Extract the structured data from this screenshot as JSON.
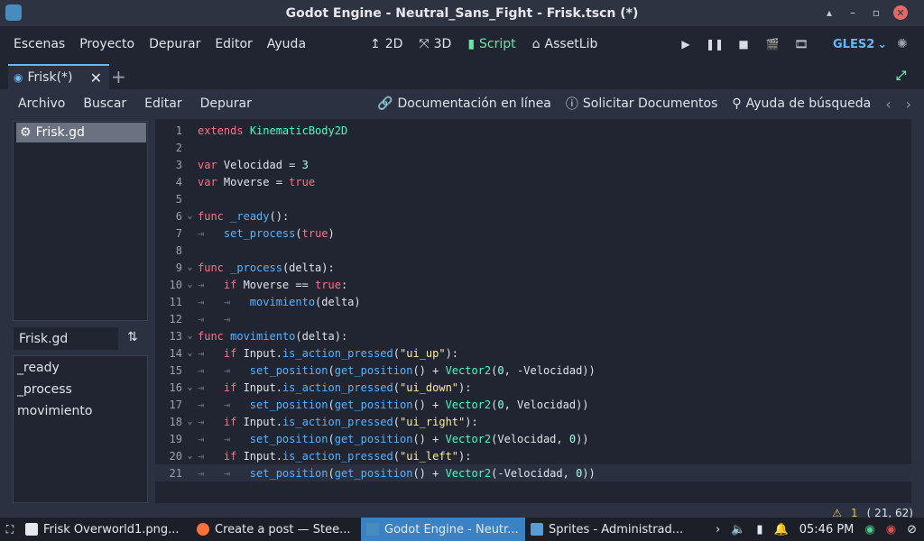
{
  "window": {
    "title": "Godot Engine - Neutral_Sans_Fight - Frisk.tscn (*)",
    "controls": [
      "▴",
      "–",
      "▫"
    ]
  },
  "menu": {
    "items": [
      "Escenas",
      "Proyecto",
      "Depurar",
      "Editor",
      "Ayuda"
    ],
    "modes": [
      {
        "label": "2D",
        "icon": "2d-icon"
      },
      {
        "label": "3D",
        "icon": "3d-icon"
      },
      {
        "label": "Script",
        "icon": "script-icon"
      },
      {
        "label": "AssetLib",
        "icon": "assetlib-icon"
      }
    ],
    "active_mode": "Script",
    "renderer": "GLES2"
  },
  "scene_tab": {
    "label": "Frisk(*)"
  },
  "script_menu": {
    "items": [
      "Archivo",
      "Buscar",
      "Editar",
      "Depurar"
    ],
    "right": [
      {
        "label": "Documentación en línea",
        "icon": "link-icon"
      },
      {
        "label": "Solicitar Documentos",
        "icon": "help-circle-icon"
      },
      {
        "label": "Ayuda de búsqueda",
        "icon": "search-help-icon"
      }
    ]
  },
  "script_list": {
    "selected": "Frisk.gd"
  },
  "filter": {
    "value": "Frisk.gd"
  },
  "methods": [
    "_ready",
    "_process",
    "movimiento"
  ],
  "code": [
    {
      "n": "1",
      "fold": "",
      "parts": [
        [
          "kw",
          "extends"
        ],
        [
          "t",
          " "
        ],
        [
          "ty",
          "KinematicBody2D"
        ]
      ]
    },
    {
      "n": "2",
      "fold": "",
      "parts": []
    },
    {
      "n": "3",
      "fold": "",
      "parts": [
        [
          "kw",
          "var"
        ],
        [
          "t",
          " Velocidad = "
        ],
        [
          "num",
          "3"
        ]
      ]
    },
    {
      "n": "4",
      "fold": "",
      "parts": [
        [
          "kw",
          "var"
        ],
        [
          "t",
          " Moverse = "
        ],
        [
          "kw",
          "true"
        ]
      ]
    },
    {
      "n": "5",
      "fold": "",
      "parts": []
    },
    {
      "n": "6",
      "fold": "⌄",
      "parts": [
        [
          "kw",
          "func"
        ],
        [
          "t",
          " "
        ],
        [
          "fn",
          "_ready"
        ],
        [
          "t",
          "():"
        ]
      ]
    },
    {
      "n": "7",
      "fold": "",
      "parts": [
        [
          "tab",
          "⇥   "
        ],
        [
          "fn",
          "set_process"
        ],
        [
          "t",
          "("
        ],
        [
          "kw",
          "true"
        ],
        [
          "t",
          ")"
        ]
      ]
    },
    {
      "n": "8",
      "fold": "",
      "parts": []
    },
    {
      "n": "9",
      "fold": "⌄",
      "parts": [
        [
          "kw",
          "func"
        ],
        [
          "t",
          " "
        ],
        [
          "fn",
          "_process"
        ],
        [
          "t",
          "(delta):"
        ]
      ]
    },
    {
      "n": "10",
      "fold": "⌄",
      "parts": [
        [
          "tab",
          "⇥   "
        ],
        [
          "kw",
          "if"
        ],
        [
          "t",
          " Moverse == "
        ],
        [
          "kw",
          "true"
        ],
        [
          "t",
          ":"
        ]
      ]
    },
    {
      "n": "11",
      "fold": "",
      "parts": [
        [
          "tab",
          "⇥   ⇥   "
        ],
        [
          "fn",
          "movimiento"
        ],
        [
          "t",
          "(delta)"
        ]
      ]
    },
    {
      "n": "12",
      "fold": "",
      "parts": [
        [
          "tab",
          "⇥   ⇥"
        ]
      ]
    },
    {
      "n": "13",
      "fold": "⌄",
      "parts": [
        [
          "kw",
          "func"
        ],
        [
          "t",
          " "
        ],
        [
          "fn",
          "movimiento"
        ],
        [
          "t",
          "(delta):"
        ]
      ]
    },
    {
      "n": "14",
      "fold": "⌄",
      "parts": [
        [
          "tab",
          "⇥   "
        ],
        [
          "kw",
          "if"
        ],
        [
          "t",
          " Input."
        ],
        [
          "fn",
          "is_action_pressed"
        ],
        [
          "t",
          "("
        ],
        [
          "str",
          "\"ui_up\""
        ],
        [
          "t",
          "):"
        ]
      ]
    },
    {
      "n": "15",
      "fold": "",
      "parts": [
        [
          "tab",
          "⇥   ⇥   "
        ],
        [
          "fn",
          "set_position"
        ],
        [
          "t",
          "("
        ],
        [
          "fn",
          "get_position"
        ],
        [
          "t",
          "() + "
        ],
        [
          "ty",
          "Vector2"
        ],
        [
          "t",
          "("
        ],
        [
          "num",
          "0"
        ],
        [
          "t",
          ", -Velocidad))"
        ]
      ]
    },
    {
      "n": "16",
      "fold": "⌄",
      "parts": [
        [
          "tab",
          "⇥   "
        ],
        [
          "kw",
          "if"
        ],
        [
          "t",
          " Input."
        ],
        [
          "fn",
          "is_action_pressed"
        ],
        [
          "t",
          "("
        ],
        [
          "str",
          "\"ui_down\""
        ],
        [
          "t",
          "):"
        ]
      ]
    },
    {
      "n": "17",
      "fold": "",
      "parts": [
        [
          "tab",
          "⇥   ⇥   "
        ],
        [
          "fn",
          "set_position"
        ],
        [
          "t",
          "("
        ],
        [
          "fn",
          "get_position"
        ],
        [
          "t",
          "() + "
        ],
        [
          "ty",
          "Vector2"
        ],
        [
          "t",
          "("
        ],
        [
          "num",
          "0"
        ],
        [
          "t",
          ", Velocidad))"
        ]
      ]
    },
    {
      "n": "18",
      "fold": "⌄",
      "parts": [
        [
          "tab",
          "⇥   "
        ],
        [
          "kw",
          "if"
        ],
        [
          "t",
          " Input."
        ],
        [
          "fn",
          "is_action_pressed"
        ],
        [
          "t",
          "("
        ],
        [
          "str",
          "\"ui_right\""
        ],
        [
          "t",
          "):"
        ]
      ]
    },
    {
      "n": "19",
      "fold": "",
      "parts": [
        [
          "tab",
          "⇥   ⇥   "
        ],
        [
          "fn",
          "set_position"
        ],
        [
          "t",
          "("
        ],
        [
          "fn",
          "get_position"
        ],
        [
          "t",
          "() + "
        ],
        [
          "ty",
          "Vector2"
        ],
        [
          "t",
          "(Velocidad, "
        ],
        [
          "num",
          "0"
        ],
        [
          "t",
          "))"
        ]
      ]
    },
    {
      "n": "20",
      "fold": "⌄",
      "parts": [
        [
          "tab",
          "⇥   "
        ],
        [
          "kw",
          "if"
        ],
        [
          "t",
          " Input."
        ],
        [
          "fn",
          "is_action_pressed"
        ],
        [
          "t",
          "("
        ],
        [
          "str",
          "\"ui_left\""
        ],
        [
          "t",
          "):"
        ]
      ]
    },
    {
      "n": "21",
      "fold": "",
      "parts": [
        [
          "tab",
          "⇥   ⇥   "
        ],
        [
          "fn",
          "set_position"
        ],
        [
          "t",
          "("
        ],
        [
          "fn",
          "get_position"
        ],
        [
          "t",
          "() + "
        ],
        [
          "ty",
          "Vector2"
        ],
        [
          "t",
          "(-Velocidad, "
        ],
        [
          "num",
          "0"
        ],
        [
          "t",
          "))"
        ]
      ]
    }
  ],
  "current_line": "21",
  "status": {
    "warnings": "1",
    "position": "(  21,  62)"
  },
  "taskbar": {
    "items": [
      {
        "label": "Frisk Overworld1.png...",
        "color": "#e6e8ee"
      },
      {
        "label": "Create a post — Stee...",
        "color": "#ff7139"
      },
      {
        "label": "Godot Engine - Neutr...",
        "color": "#478cbf"
      },
      {
        "label": "Sprites - Administrad...",
        "color": "#5b9bd5"
      }
    ],
    "active_index": 2,
    "clock": "05:46 PM"
  },
  "colors": {
    "accent": "#6cb6f0",
    "script_active": "#6fe3a6",
    "editor_bg": "#202531",
    "keyword": "#ff7085",
    "type": "#42ffc2",
    "function": "#57b3ff",
    "number": "#a1ffe0",
    "string": "#ffeda1"
  }
}
